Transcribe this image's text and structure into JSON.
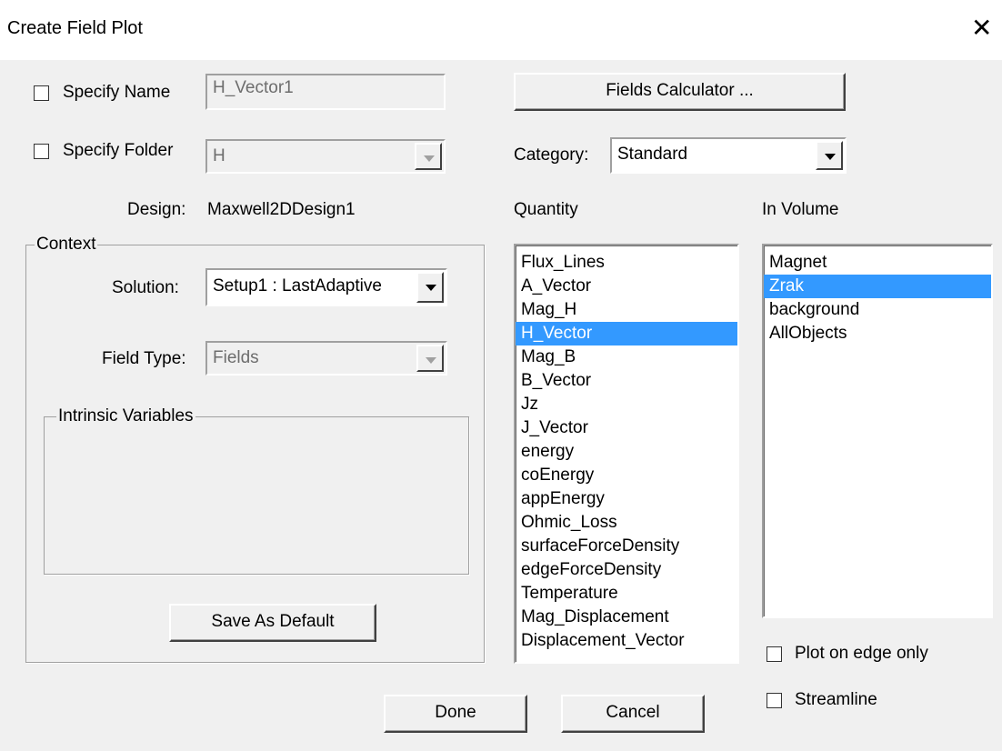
{
  "window": {
    "title": "Create Field Plot"
  },
  "specify_name": {
    "label": "Specify Name",
    "value": "H_Vector1",
    "checked": false
  },
  "specify_folder": {
    "label": "Specify Folder",
    "value": "H",
    "checked": false
  },
  "fields_calculator": {
    "label": "Fields Calculator ..."
  },
  "category": {
    "label": "Category:",
    "value": "Standard"
  },
  "design": {
    "label": "Design:",
    "value": "Maxwell2DDesign1"
  },
  "context": {
    "legend": "Context",
    "solution_label": "Solution:",
    "solution_value": "Setup1 : LastAdaptive",
    "field_type_label": "Field Type:",
    "field_type_value": "Fields",
    "intrinsic_legend": "Intrinsic Variables",
    "save_default": "Save As Default"
  },
  "quantity": {
    "header": "Quantity",
    "items": [
      "Flux_Lines",
      "A_Vector",
      "Mag_H",
      "H_Vector",
      "Mag_B",
      "B_Vector",
      "Jz",
      "J_Vector",
      "energy",
      "coEnergy",
      "appEnergy",
      "Ohmic_Loss",
      "surfaceForceDensity",
      "edgeForceDensity",
      "Temperature",
      "Mag_Displacement",
      "Displacement_Vector"
    ],
    "selected": "H_Vector"
  },
  "in_volume": {
    "header": "In Volume",
    "items": [
      "Magnet",
      "Zrak",
      "background",
      "AllObjects"
    ],
    "selected": "Zrak"
  },
  "options": {
    "plot_edge_only": {
      "label": "Plot on edge only",
      "checked": false
    },
    "streamline": {
      "label": "Streamline",
      "checked": false
    }
  },
  "buttons": {
    "done": "Done",
    "cancel": "Cancel"
  },
  "colors": {
    "selection": "#3399ff",
    "dialog_bg": "#f0f0f0"
  },
  "icons": {
    "close": "close-icon",
    "dropdown": "chevron-down-icon"
  }
}
